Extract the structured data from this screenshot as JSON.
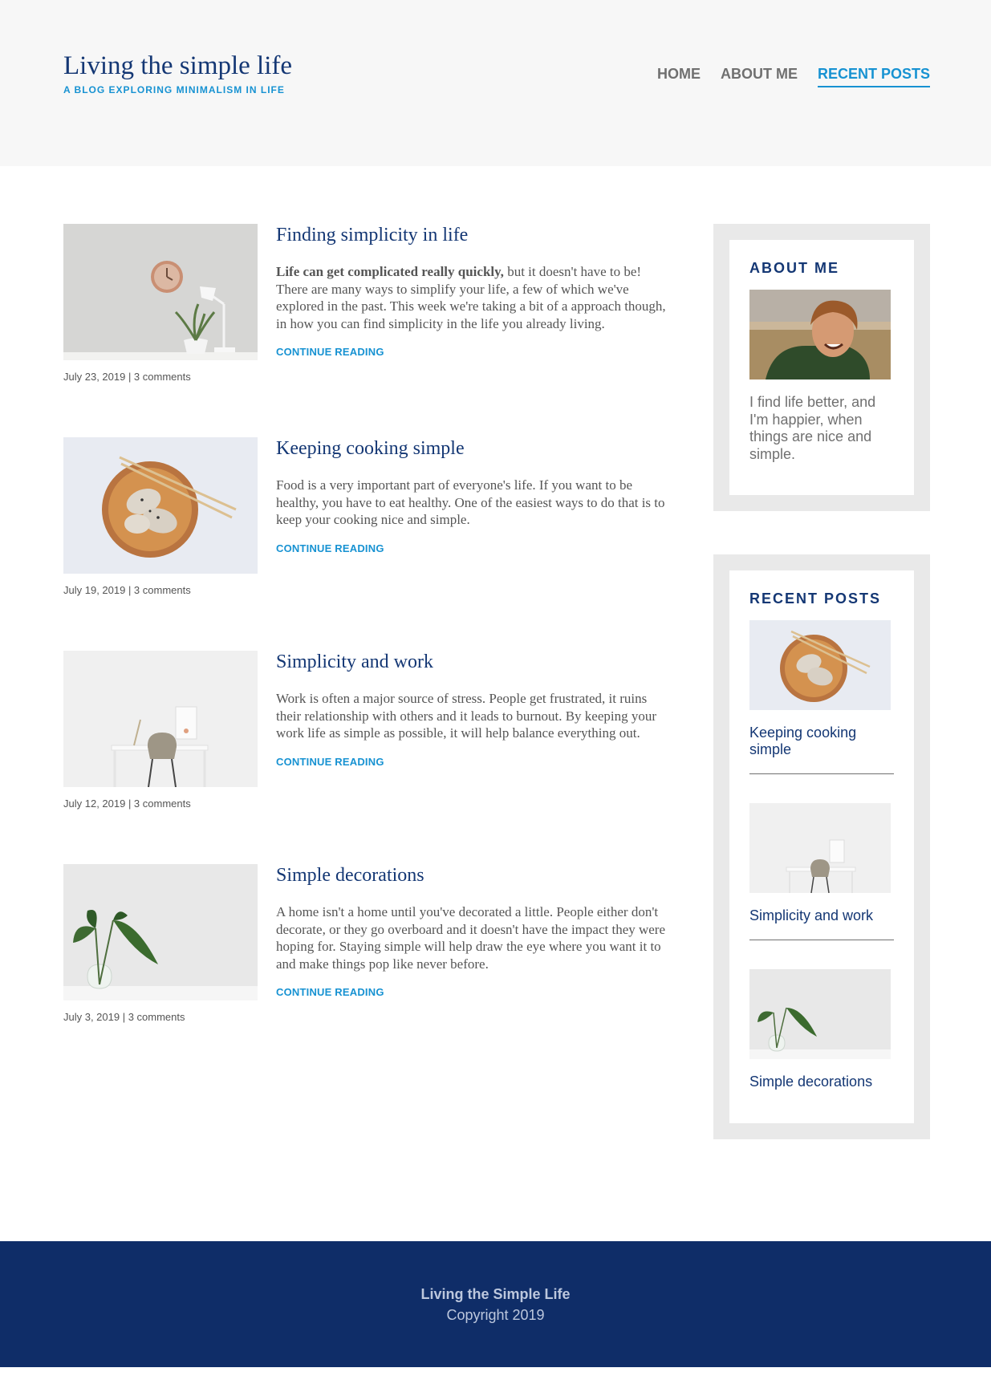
{
  "header": {
    "title": "Living the simple life",
    "tagline": "A blog exploring minimalism in life",
    "nav": [
      {
        "label": "HOME",
        "active": false
      },
      {
        "label": "ABOUT ME",
        "active": false
      },
      {
        "label": "RECENT POSTS",
        "active": true
      }
    ]
  },
  "posts": [
    {
      "title": "Finding simplicity in life",
      "excerpt_bold": "Life can get complicated really quickly,",
      "excerpt": " but it doesn't have to be! There are many ways to simplify your life, a few of which we've explored in the past. This week we're taking a bit of a approach though, in how you can find simplicity in the life you already living.",
      "meta": "July 23, 2019 | 3 comments",
      "read_more": "CONTINUE READING",
      "image_icon": "clock-and-lamp-image"
    },
    {
      "title": "Keeping cooking simple",
      "excerpt_bold": "",
      "excerpt": "Food is a very important part of everyone's life. If you want to be healthy, you have to eat healthy. One of the easiest ways to do that is to keep your cooking nice and simple.",
      "meta": "July 19, 2019 | 3 comments",
      "read_more": "CONTINUE READING",
      "image_icon": "dumplings-image"
    },
    {
      "title": "Simplicity and work",
      "excerpt_bold": "",
      "excerpt": "Work is often a major source of stress. People get frustrated, it ruins their relationship with others and it leads to burnout. By keeping your work life as simple as possible, it will help balance everything out.",
      "meta": "July 12, 2019 | 3 comments",
      "read_more": "CONTINUE READING",
      "image_icon": "desk-and-chair-image"
    },
    {
      "title": "Simple decorations",
      "excerpt_bold": "",
      "excerpt": "A home isn't a home until you've decorated a little. People either don't decorate, or they go overboard and it doesn't have the impact they were hoping for. Staying simple will help draw the eye where you want it to and make things pop like never before.",
      "meta": "July 3, 2019 | 3 comments",
      "read_more": "CONTINUE READING",
      "image_icon": "plant-vase-image"
    }
  ],
  "sidebar": {
    "about": {
      "title": "About me",
      "text": "I find life better, and I'm happier, when things are nice and simple.",
      "image_icon": "smiling-man-image"
    },
    "recent": {
      "title": "Recent posts",
      "items": [
        {
          "title": "Keeping cooking simple",
          "image_icon": "dumplings-image"
        },
        {
          "title": "Simplicity and work",
          "image_icon": "desk-and-chair-image"
        },
        {
          "title": "Simple decorations",
          "image_icon": "plant-vase-image"
        }
      ]
    }
  },
  "footer": {
    "title": "Living the Simple Life",
    "copyright": "Copyright 2019"
  },
  "colors": {
    "brand_dark": "#143774",
    "accent": "#1792d2",
    "footer_bg": "#0f2d68",
    "header_bg": "#f7f7f7",
    "widget_border": "#e9e9e9"
  }
}
